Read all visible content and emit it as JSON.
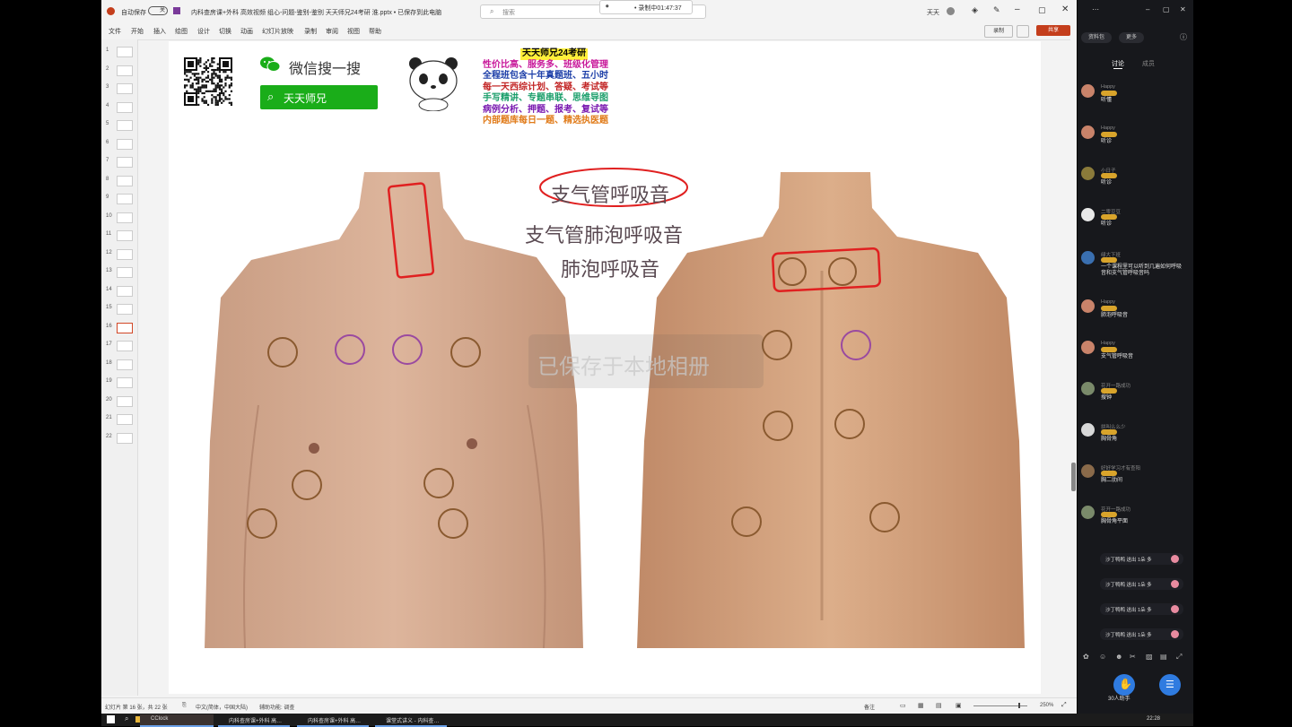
{
  "window": {
    "autosave_label": "自动保存",
    "autosave_state": "关",
    "title": "内科查房课+外科 高效视频 组心-问题-鉴别-鉴别 天天师兄24考研 淮.pptx • 已保存到此电脑",
    "search_placeholder": "搜索",
    "recording_timer": "• 录制中01:47:37",
    "user_name": "天天"
  },
  "ribbon": {
    "menu": [
      "文件",
      "开始",
      "插入",
      "绘图",
      "设计",
      "切换",
      "动画",
      "幻灯片放映",
      "录制",
      "审阅",
      "视图",
      "帮助"
    ],
    "record_button": "录制",
    "share_button": "共享"
  },
  "thumbnails": {
    "numbers": [
      "1",
      "2",
      "3",
      "4",
      "5",
      "6",
      "7",
      "8",
      "9",
      "10",
      "11",
      "12",
      "13",
      "14",
      "15",
      "16",
      "17",
      "18",
      "19",
      "20",
      "21",
      "22"
    ],
    "active_index": 16
  },
  "slide": {
    "wechat_search_text": "微信搜一搜",
    "search_chip_label": "天天师兄",
    "promo": {
      "title": "天天师兄24考研",
      "lines": [
        {
          "text": "性价比高、服务多、班级化管理",
          "color": "#c8189a"
        },
        {
          "text": "全程班包含十年真题班、五小时",
          "color": "#1d3fa8"
        },
        {
          "text": "每一天西综计划、答疑、考试等",
          "color": "#c22424"
        },
        {
          "text": "手写精讲、专题串联、思维导图",
          "color": "#1a9e6a"
        },
        {
          "text": "病例分析、押题、报考、复试等",
          "color": "#7a1ab0"
        },
        {
          "text": "内部题库每日一题、精选执医题",
          "color": "#e07a18"
        }
      ]
    },
    "sound_labels": {
      "tracheal": "支气管呼吸音",
      "bronchovesicular": "支气管肺泡呼吸音",
      "vesicular": "肺泡呼吸音"
    },
    "watermark": "已保存于本地相册"
  },
  "statusbar": {
    "slide_info": "幻灯片 第 16 张，共 22 张",
    "language": "中文(简体，中国大陆)",
    "accessibility": "辅助功能: 调查",
    "notes": "备注",
    "zoom": "250%"
  },
  "chat": {
    "tabs": [
      "讨论",
      "成员"
    ],
    "top_buttons": [
      "资料包",
      "更多"
    ],
    "messages": [
      {
        "name": "Happy",
        "text": "听懂",
        "avatar_color": "#c9836a"
      },
      {
        "name": "Happy",
        "text": "听诊",
        "avatar_color": "#c9836a"
      },
      {
        "name": "小日子",
        "text": "听诊",
        "avatar_color": "#8a7a3a"
      },
      {
        "name": "二零豆豆",
        "text": "听诊",
        "avatar_color": "#e8e8e8"
      },
      {
        "name": "绿大下班",
        "text": "一个课程里可以听到几遍如何呼吸音和支气管呼吸音吗",
        "avatar_color": "#3a6fb0"
      },
      {
        "name": "Happy",
        "text": "肺泡呼吸音",
        "avatar_color": "#c9836a"
      },
      {
        "name": "Happy",
        "text": "支气管呼吸音",
        "avatar_color": "#c9836a"
      },
      {
        "name": "花开一路成功",
        "text": "搜钟",
        "avatar_color": "#7a8a6a"
      },
      {
        "name": "拼叫么么少",
        "text": "胸骨角",
        "avatar_color": "#d8d8d8"
      },
      {
        "name": "好好学习才有查阳",
        "text": "胸二肋间",
        "avatar_color": "#8a6a4a"
      },
      {
        "name": "花开一路成功",
        "text": "胸骨角平面",
        "avatar_color": "#7a8a6a"
      }
    ],
    "gifts": [
      "沙丁鸭鸭 送出 1朵 多",
      "沙丁鸭鸭 送出 1朵 多",
      "沙丁鸭鸭 送出 1朵 多",
      "沙丁鸭鸭 送出 1朵 多"
    ],
    "helper_label": "30人助手"
  },
  "taskbar": {
    "items": [
      "CClock",
      "内科查房课+外科 高…",
      "内科查房课+外科 高…",
      "课堂式讲义 - 内科查…"
    ],
    "time": "22:28"
  }
}
